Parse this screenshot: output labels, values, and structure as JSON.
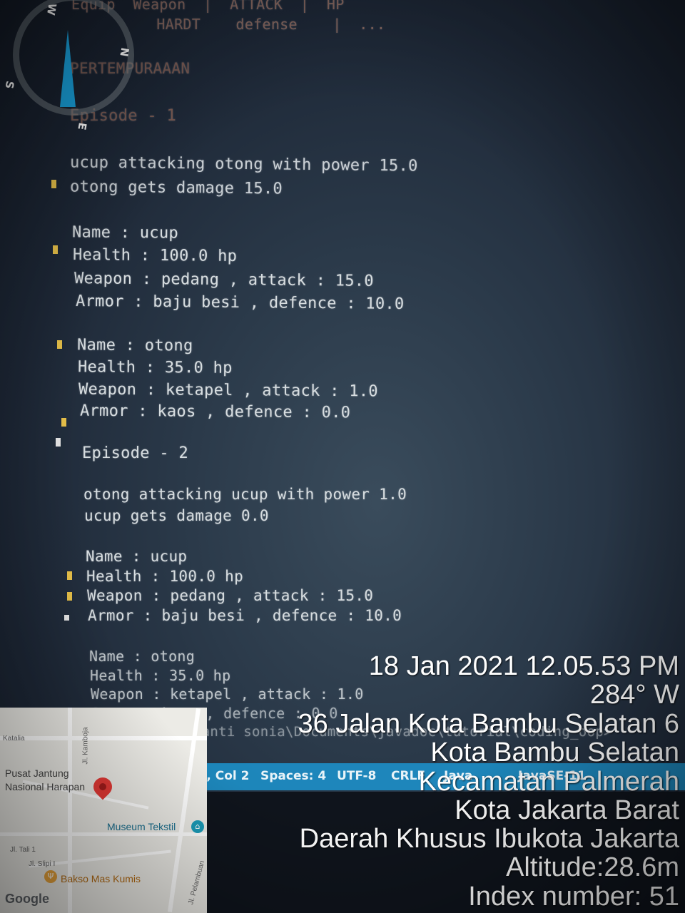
{
  "terminal": {
    "header_line1": "Equip  Weapon  |  ATTACK  |  HP",
    "header_line2": "          HARDT    defense    |  ...",
    "section_title": "PERTEMPURAAAN",
    "episode1_title": "Episode - 1",
    "ep1_attack": "ucup attacking otong with power 15.0",
    "ep1_damage": "otong gets damage 15.0",
    "ep1_p1_name": "Name : ucup",
    "ep1_p1_health": "Health : 100.0 hp",
    "ep1_p1_weapon": "Weapon : pedang , attack : 15.0",
    "ep1_p1_armor": "Armor : baju besi , defence : 10.0",
    "ep1_p2_name": "Name : otong",
    "ep1_p2_health": "Health : 35.0 hp",
    "ep1_p2_weapon": "Weapon : ketapel , attack : 1.0",
    "ep1_p2_armor": "Armor : kaos , defence : 0.0",
    "episode2_title": "Episode - 2",
    "ep2_attack": "otong attacking ucup with power 1.0",
    "ep2_damage": "ucup gets damage 0.0",
    "ep2_p1_name": "Name : ucup",
    "ep2_p1_health": "Health : 100.0 hp",
    "ep2_p1_weapon": "Weapon : pedang , attack : 15.0",
    "ep2_p1_armor": "Armor : baju besi , defence : 10.0",
    "ep2_p2_name": "Name : otong",
    "ep2_p2_health": "Health : 35.0 hp",
    "ep2_p2_weapon": "Weapon : ketapel , attack : 1.0",
    "ep2_p2_armor": "Armor : kaos , defence : 0.0",
    "prompt": "PS C:\\Users\\santi sonia\\Documents\\javadoc\\tutorial\\coding_oop>"
  },
  "statusbar": {
    "position": "Ln 139, Col 2",
    "spaces": "Spaces: 4",
    "encoding": "UTF-8",
    "eol": "CRLF",
    "language": "Java",
    "runtime": "JavaSE-11"
  },
  "compass": {
    "n": "N",
    "e": "E",
    "s": "S",
    "w": "W"
  },
  "map": {
    "label_katalia": "Katalia",
    "label_kamboja": "Jl. Kamboja",
    "label_pusat_1": "Pusat Jantung",
    "label_pusat_2": "Nasional Harapan",
    "label_museum": "Museum Tekstil",
    "label_tali": "Jl. Tali 1",
    "label_slipi": "Jl. Slipi I",
    "label_bakso": "Bakso Mas Kumis",
    "label_pelambuan": "Jl. Pelambuan",
    "google": "Google"
  },
  "overlay": {
    "datetime": "18 Jan 2021 12.05.53 PM",
    "bearing": "284° W",
    "street": "36 Jalan Kota Bambu Selatan 6",
    "kelurahan": "Kota Bambu Selatan",
    "kecamatan": "Kecamatan Palmerah",
    "city": "Kota Jakarta Barat",
    "province": "Daerah Khusus Ibukota Jakarta",
    "altitude": "Altitude:28.6m",
    "index": "Index number: 51"
  },
  "colors": {
    "statusbar": "#1d8fc8",
    "compass_needle": "#19a3df",
    "map_pin": "#e53935",
    "marker": "#e9c24a"
  }
}
